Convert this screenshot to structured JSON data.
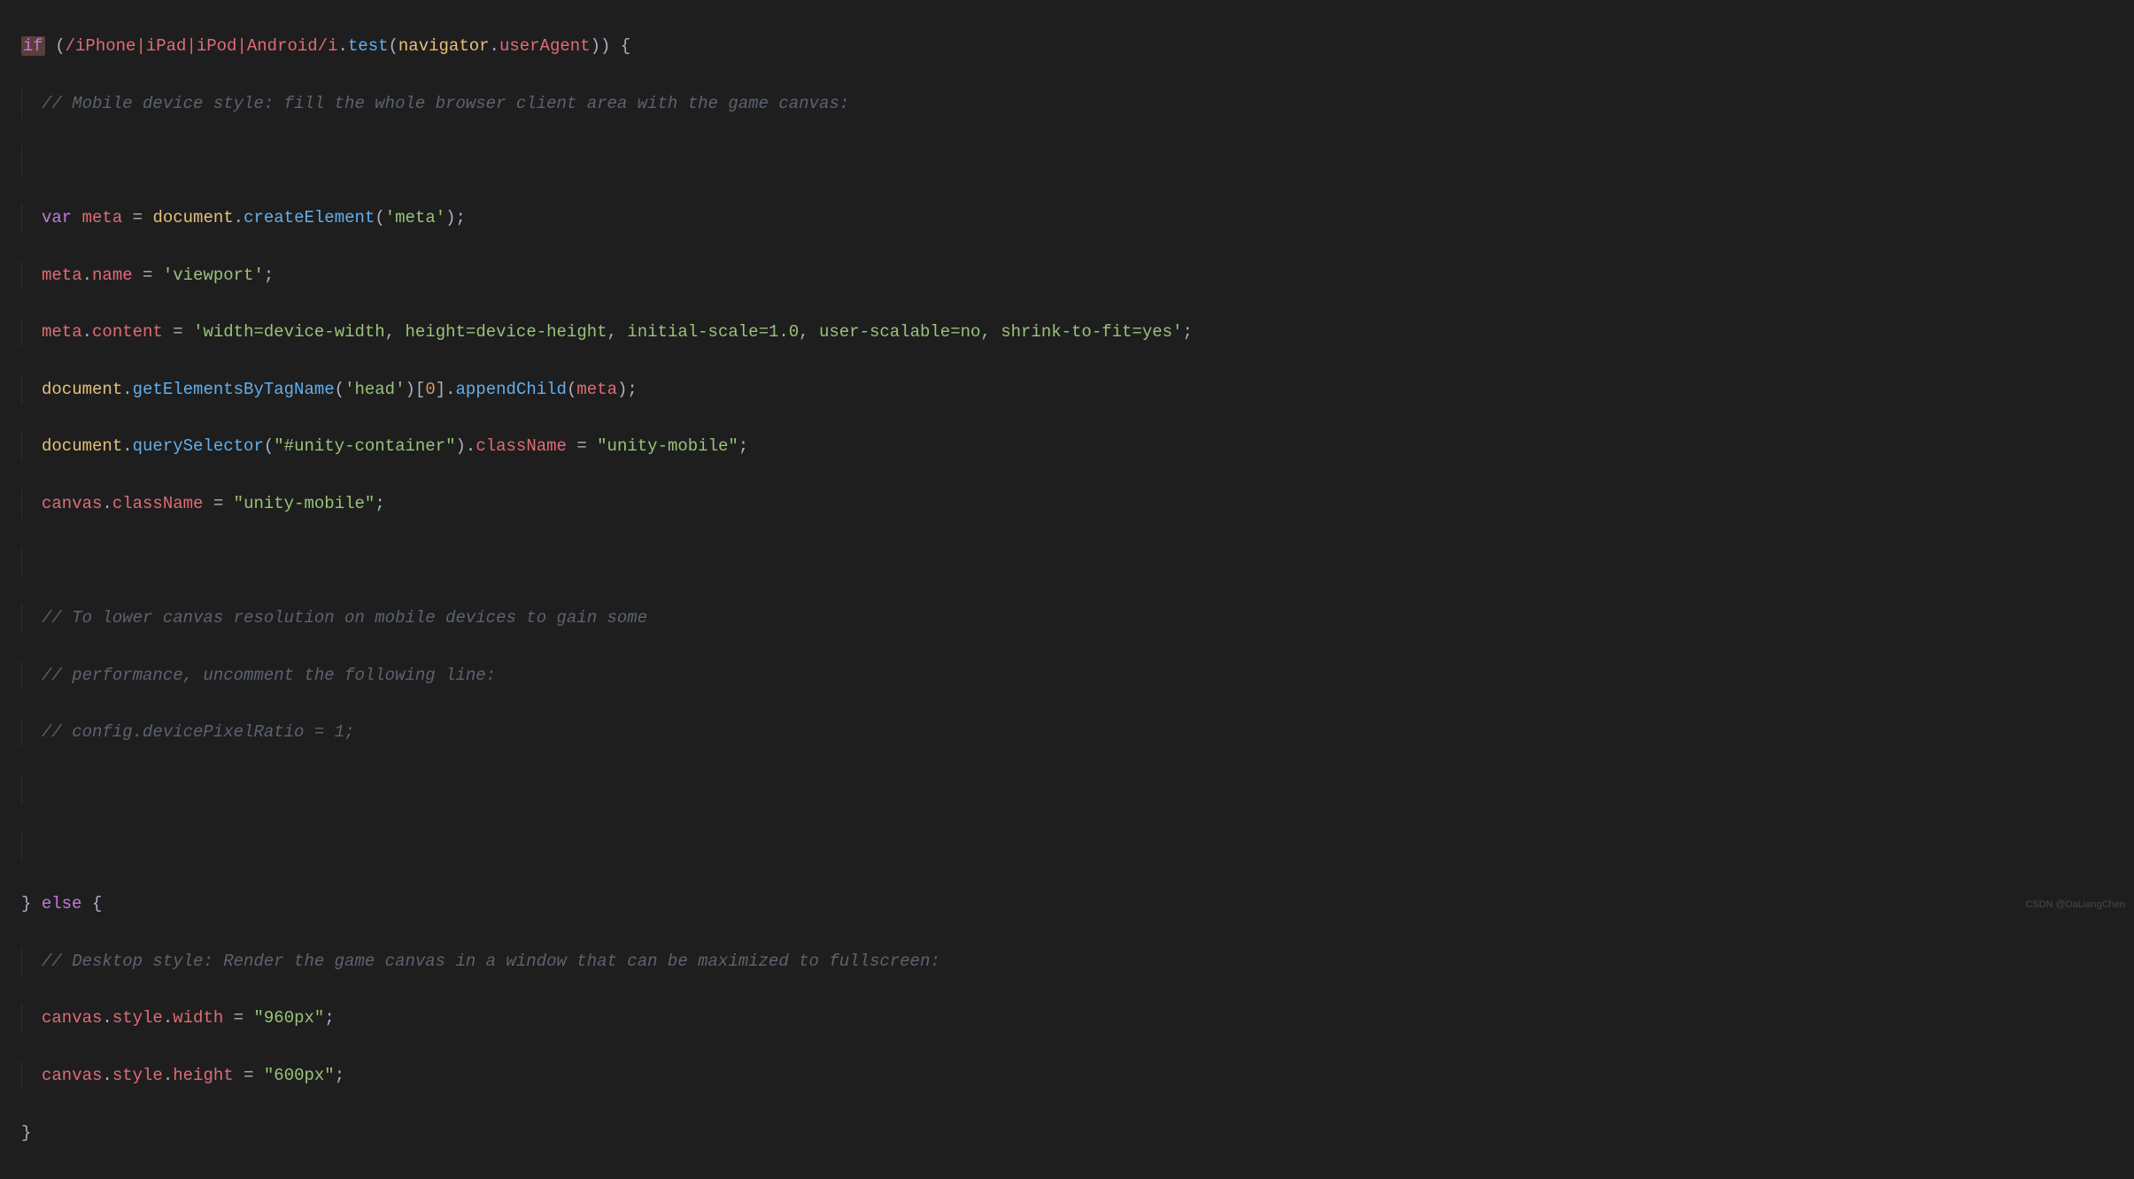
{
  "code": {
    "line1": {
      "kw_if": "if",
      "paren_open": " (",
      "regex": "/iPhone|iPad|iPod|Android/i",
      "dot1": ".",
      "fn_test": "test",
      "p_open": "(",
      "navigator": "navigator",
      "dot2": ".",
      "userAgent": "userAgent",
      "p_close": "))",
      "brace": " {"
    },
    "line2_comment": "// Mobile device style: fill the whole browser client area with the game canvas:",
    "line4": {
      "kw_var": "var",
      "sp": " ",
      "meta": "meta",
      "eq": " = ",
      "document": "document",
      "dot": ".",
      "createElement": "createElement",
      "p_open": "(",
      "str_meta": "'meta'",
      "p_close": ");"
    },
    "line5": {
      "meta": "meta",
      "dot": ".",
      "name": "name",
      "eq": " = ",
      "str": "'viewport'",
      "semi": ";"
    },
    "line6": {
      "meta": "meta",
      "dot": ".",
      "content": "content",
      "eq": " = ",
      "str": "'width=device-width, height=device-height, initial-scale=1.0, user-scalable=no, shrink-to-fit=yes'",
      "semi": ";"
    },
    "line7": {
      "document": "document",
      "dot1": ".",
      "getElementsByTagName": "getElementsByTagName",
      "p_open": "(",
      "str_head": "'head'",
      "p_close": ")",
      "bracket_open": "[",
      "zero": "0",
      "bracket_close": "]",
      "dot2": ".",
      "appendChild": "appendChild",
      "p_open2": "(",
      "meta": "meta",
      "p_close2": ");"
    },
    "line8": {
      "document": "document",
      "dot1": ".",
      "querySelector": "querySelector",
      "p_open": "(",
      "str": "\"#unity-container\"",
      "p_close": ")",
      "dot2": ".",
      "className": "className",
      "eq": " = ",
      "str2": "\"unity-mobile\"",
      "semi": ";"
    },
    "line9": {
      "canvas": "canvas",
      "dot": ".",
      "className": "className",
      "eq": " = ",
      "str": "\"unity-mobile\"",
      "semi": ";"
    },
    "line11_comment": "// To lower canvas resolution on mobile devices to gain some",
    "line12_comment": "// performance, uncomment the following line:",
    "line13_comment": "// config.devicePixelRatio = 1;",
    "line16": {
      "brace_close": "}",
      "sp": " ",
      "kw_else": "else",
      "brace_open": " {"
    },
    "line17_comment": "// Desktop style: Render the game canvas in a window that can be maximized to fullscreen:",
    "line18": {
      "canvas": "canvas",
      "dot1": ".",
      "style": "style",
      "dot2": ".",
      "width": "width",
      "eq": " = ",
      "str": "\"960px\"",
      "semi": ";"
    },
    "line19": {
      "canvas": "canvas",
      "dot1": ".",
      "style": "style",
      "dot2": ".",
      "height": "height",
      "eq": " = ",
      "str": "\"600px\"",
      "semi": ";"
    },
    "line20_brace": "}"
  },
  "watermark": "CSDN @DaLiangChen"
}
